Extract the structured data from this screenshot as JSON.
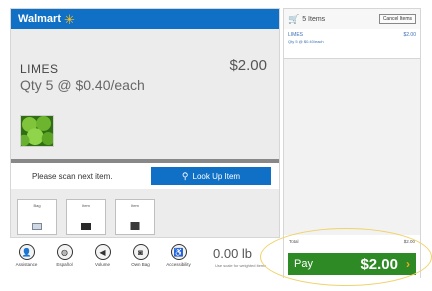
{
  "header": {
    "brand": "Walmart",
    "spark": "✳"
  },
  "item": {
    "name": "LIMES",
    "qty": "Qty 5 @ $0.40/each",
    "price": "$2.00"
  },
  "scan": {
    "prompt": "Please scan next item.",
    "lookup_label": "Look Up Item",
    "lookup_icon": "search-icon"
  },
  "tiles": [
    {
      "label": "Bag",
      "icon": "bag-icon"
    },
    {
      "label": "Item",
      "icon": "item-icon"
    },
    {
      "label": "Item",
      "icon": "item-icon"
    }
  ],
  "toolbar": {
    "buttons": [
      {
        "label": "Assistance",
        "icon": "person-icon"
      },
      {
        "label": "Español",
        "icon": "globe-icon"
      },
      {
        "label": "Volume",
        "icon": "speaker-icon"
      },
      {
        "label": "Own Bag",
        "icon": "bag-icon"
      },
      {
        "label": "Accessibility",
        "icon": "accessibility-icon"
      }
    ],
    "weight": "0.00 lb",
    "weight_note": "Use scale for weighted items"
  },
  "cart": {
    "count": "5 Items",
    "cancel_label": "Cancel Items",
    "line": {
      "name": "LIMES",
      "price": "$2.00",
      "sub": "Qty 5 @ $0.40/each"
    }
  },
  "totals": {
    "label": "Total",
    "value": "$2.00",
    "pay_label": "Pay",
    "pay_amount": "$2.00",
    "pay_arrow": "›"
  },
  "colors": {
    "brand_blue": "#0f70c6",
    "pay_green": "#2e8a24",
    "spark_yellow": "#ffc220",
    "highlight": "#f0d26a"
  }
}
